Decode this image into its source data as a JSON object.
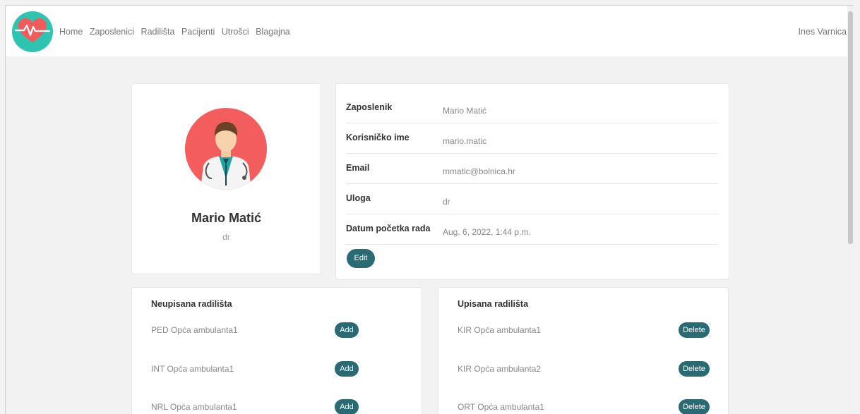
{
  "nav": {
    "links": [
      "Home",
      "Zaposlenici",
      "Radilišta",
      "Pacijenti",
      "Utrošci",
      "Blagajna"
    ],
    "user": "Ines Varnica"
  },
  "profile": {
    "name": "Mario Matić",
    "role": "dr"
  },
  "details": [
    {
      "label": "Zaposlenik",
      "value": "Mario Matić"
    },
    {
      "label": "Korisničko ime",
      "value": "mario.matic"
    },
    {
      "label": "Email",
      "value": "mmatic@bolnica.hr"
    },
    {
      "label": "Uloga",
      "value": "dr"
    },
    {
      "label": "Datum početka rada",
      "value": "Aug. 6, 2022, 1:44 p.m."
    }
  ],
  "edit_label": "Edit",
  "unassigned": {
    "title": "Neupisana radilišta",
    "button_label": "Add",
    "items": [
      "PED Opća ambulanta1",
      "INT Opća ambulanta1",
      "NRL Opća ambulanta1"
    ]
  },
  "assigned": {
    "title": "Upisana radilišta",
    "button_label": "Delete",
    "items": [
      "KIR Opća ambulanta1",
      "KIR Opća ambulanta2",
      "ORT Opća ambulanta1"
    ]
  },
  "colors": {
    "accent": "#2a6a72",
    "logo_bg": "#2fc4b2",
    "avatar_bg": "#f45d5d"
  }
}
